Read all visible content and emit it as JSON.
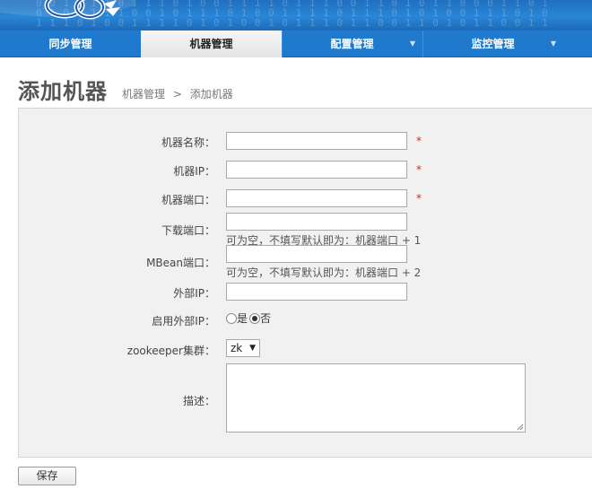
{
  "nav": {
    "items": [
      {
        "label": "同步管理",
        "active": false,
        "has_dropdown": false
      },
      {
        "label": "机器管理",
        "active": true,
        "has_dropdown": false
      },
      {
        "label": "配置管理",
        "active": false,
        "has_dropdown": true
      },
      {
        "label": "监控管理",
        "active": false,
        "has_dropdown": true
      }
    ]
  },
  "page": {
    "title": "添加机器",
    "breadcrumb": {
      "parent": "机器管理",
      "separator": ">",
      "current": "添加机器"
    }
  },
  "form": {
    "name": {
      "label": "机器名称：",
      "value": "",
      "required_mark": "*"
    },
    "ip": {
      "label": "机器IP：",
      "value": "",
      "required_mark": "*"
    },
    "port": {
      "label": "机器端口：",
      "value": "",
      "required_mark": "*"
    },
    "download_port": {
      "label": "下载端口：",
      "value": "",
      "hint": "可为空，不填写默认即为：机器端口 + 1"
    },
    "mbean_port": {
      "label": "MBean端口：",
      "value": "",
      "hint": "可为空，不填写默认即为：机器端口 + 2"
    },
    "external_ip": {
      "label": "外部IP：",
      "value": ""
    },
    "use_external_ip": {
      "label": "启用外部IP：",
      "options": [
        "是",
        "否"
      ],
      "selected": "否"
    },
    "zk_cluster": {
      "label": "zookeeper集群：",
      "selected": "zk"
    },
    "description": {
      "label": "描述：",
      "value": ""
    },
    "save_label": "保存"
  },
  "colors": {
    "nav_bg": "#1f79cd",
    "required": "#e02020",
    "panel_bg": "#f1f1f1"
  }
}
